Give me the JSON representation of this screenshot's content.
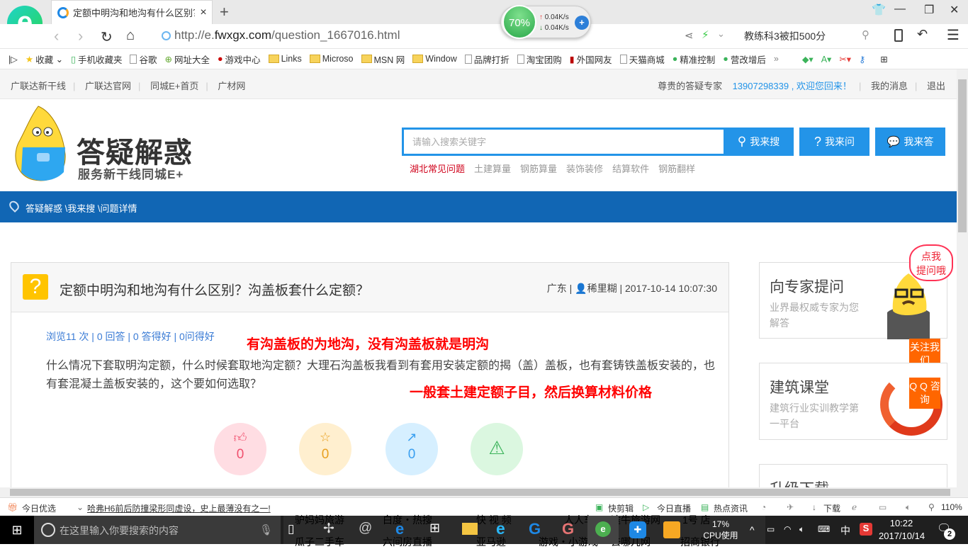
{
  "browser": {
    "tab_title": "定额中明沟和地沟有什么区别？沟",
    "url_prefix": "http://e.",
    "url_domain": "fwxgx.com",
    "url_path": "/question_1667016.html",
    "search_hint": "教练科3被扣500分",
    "net_widget": {
      "percent": "70%",
      "up": "0.04K/s",
      "down": "0.04K/s"
    },
    "bookmarks": [
      "收藏",
      "手机收藏夹",
      "谷歌",
      "网址大全",
      "游戏中心",
      "Links",
      "Microso",
      "MSN 网",
      "Window",
      "品牌打折",
      "淘宝团购",
      "外国网友",
      "天猫商城",
      "精准控制",
      "营改增后"
    ],
    "more": "»"
  },
  "topbar": {
    "links": [
      "广联达新干线",
      "广联达官网",
      "同城E+首页",
      "广材网"
    ],
    "greeting": "尊贵的答疑专家",
    "user": "13907298339 , 欢迎您回来！",
    "messages": "我的消息",
    "logout": "退出"
  },
  "header": {
    "brand": "答疑解惑",
    "slogan": "服务新干线同城E+",
    "search_placeholder": "请输入搜索关键字",
    "buttons": [
      "我来搜",
      "我来问",
      "我来答"
    ],
    "hot_tags": [
      "湖北常见问题",
      "土建算量",
      "钢筋算量",
      "装饰装修",
      "结算软件",
      "钢筋翻样"
    ]
  },
  "breadcrumb": "答疑解惑 \\我来搜 \\问题详情",
  "question": {
    "title": "定额中明沟和地沟有什么区别？沟盖板套什么定额？",
    "region": "广东",
    "author": "稀里糊",
    "time": "2017-10-14 10:07:30",
    "stats": "浏览11 次 | 0 回答 | 0 答得好 | 0问得好",
    "body": "什么情况下套取明沟定额，什么时候套取地沟定额？大理石沟盖板我看到有套用安装定额的揭（盖）盖板，也有套铸铁盖板安装的，也有套混凝土盖板安装的，这个要如何选取？",
    "annotation1": "有沟盖板的为地沟，没有沟盖板就是明沟",
    "annotation2": "一般套土建定额子目，然后换算材料价格",
    "actions": [
      {
        "icon": "thumbs-up-icon",
        "count": "0",
        "bg": "#ffdde3",
        "color": "#f0506e"
      },
      {
        "icon": "star-icon",
        "count": "0",
        "bg": "#ffefcf",
        "color": "#e8a020"
      },
      {
        "icon": "share-icon",
        "count": "0",
        "bg": "#d6efff",
        "color": "#3a9ff0"
      },
      {
        "icon": "warning-icon",
        "count": "",
        "bg": "#dbf7e0",
        "color": "#3bb35a"
      }
    ]
  },
  "sidebar": {
    "bubble": "点我\n提问哦",
    "panels": [
      {
        "title": "向专家提问",
        "desc": "业界最权威专家为您解答"
      },
      {
        "title": "建筑课堂",
        "desc": "建筑行业实训教学第一平台"
      },
      {
        "title": "升级下载",
        "desc": ""
      }
    ],
    "follow": "关注我们",
    "qq": "Q Q 咨询"
  },
  "statusbar": {
    "today": "今日优选",
    "news": "哈弗H6前后防撞梁形同虚设，史上最薄没有之一!",
    "items": [
      "快剪辑",
      "今日直播",
      "热点资讯",
      "下载"
    ],
    "zoom": "110%"
  },
  "taskbar": {
    "search_placeholder": "在这里输入你要搜索的内容",
    "cpu_percent": "17%",
    "cpu_label": "CPU使用",
    "ime": "中",
    "time": "10:22",
    "date": "2017/10/14",
    "notifications": "2",
    "ghost_text": [
      "驴妈妈旅游",
      "瓜子二手车",
      "白度・热搜",
      "六间房直播",
      "快 视 频",
      "亚马逊",
      "人人车",
      "游戏・小游戏",
      "途牛旅游网",
      "去哪儿网",
      "1号 店",
      "招商银行"
    ]
  },
  "colors": {
    "accent": "#2394e8",
    "nav": "#1166b4",
    "orange": "#ff6600",
    "annotation": "#ff0000"
  }
}
